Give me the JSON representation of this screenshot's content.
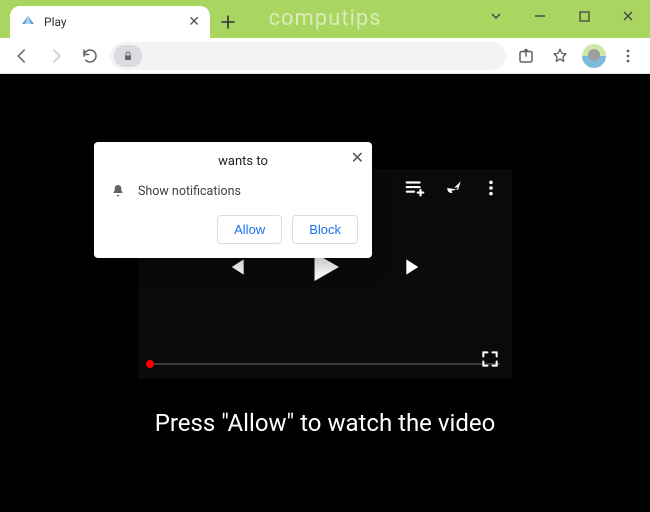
{
  "window": {
    "watermark": "computips"
  },
  "tab": {
    "title": "Play"
  },
  "permission": {
    "header": "wants to",
    "item": "Show notifications",
    "allow": "Allow",
    "block": "Block"
  },
  "page": {
    "caption": "Press \"Allow\" to watch the video"
  }
}
